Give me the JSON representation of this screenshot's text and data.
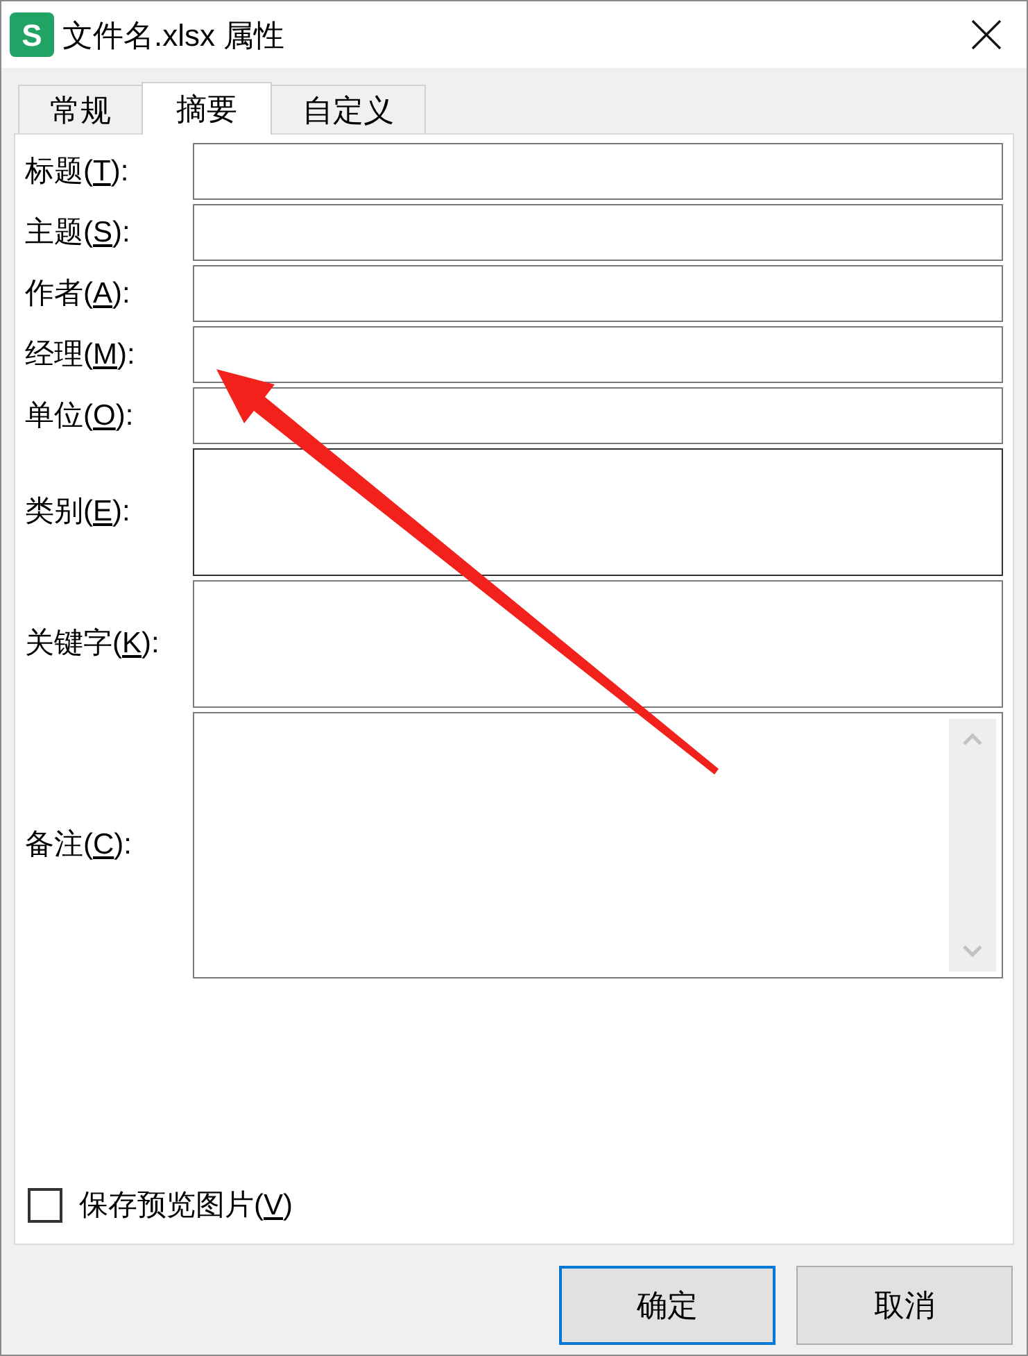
{
  "window": {
    "title": "文件名.xlsx 属性",
    "app_icon_letter": "S"
  },
  "tabs": [
    {
      "label": "常规",
      "selected": false
    },
    {
      "label": "摘要",
      "selected": true
    },
    {
      "label": "自定义",
      "selected": false
    }
  ],
  "fields": [
    {
      "before": "标题(",
      "key": "T",
      "after": "):",
      "kind": "line"
    },
    {
      "before": "主题(",
      "key": "S",
      "after": "):",
      "kind": "line"
    },
    {
      "before": "作者(",
      "key": "A",
      "after": "):",
      "kind": "line"
    },
    {
      "before": "经理(",
      "key": "M",
      "after": "):",
      "kind": "line"
    },
    {
      "before": "单位(",
      "key": "O",
      "after": "):",
      "kind": "line"
    },
    {
      "before": "类别(",
      "key": "E",
      "after": "):",
      "kind": "area"
    },
    {
      "before": "关键字(",
      "key": "K",
      "after": "):",
      "kind": "area"
    },
    {
      "before": "备注(",
      "key": "C",
      "after": "):",
      "kind": "scroll"
    }
  ],
  "save_preview": {
    "before": "保存预览图片(",
    "key": "V",
    "after": ")",
    "checked": false
  },
  "buttons": [
    {
      "label": "确定",
      "selected": true
    },
    {
      "label": "取消",
      "selected": false
    }
  ]
}
